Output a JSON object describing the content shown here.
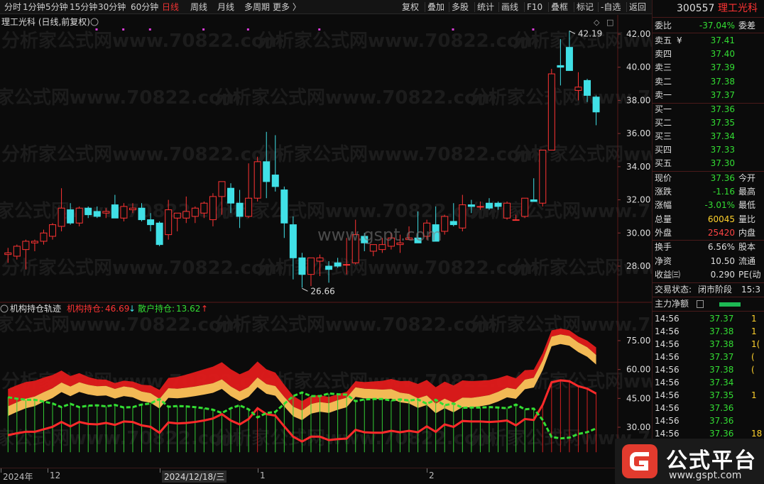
{
  "toolbar": {
    "items": [
      "分时",
      "1分钟",
      "5分钟",
      "15分钟",
      "30分钟",
      "60分钟",
      "日线",
      "周线",
      "月线",
      "多周期",
      "更多 〉"
    ],
    "active": "日线",
    "right": [
      "复权",
      "叠加",
      "多股",
      "统计",
      "画线",
      "F10",
      "叠框",
      "标记",
      "-自选",
      "返回"
    ]
  },
  "chart": {
    "title": "理工光科 (日线,前复权)",
    "price_axis": [
      "42.00",
      "40.00",
      "38.00",
      "36.00",
      "34.00",
      "32.00",
      "30.00",
      "28.00"
    ],
    "max_label": "42.19",
    "min_label": "26.66",
    "watermark_site": "www.gspt.com",
    "watermark_text": "分析家公式网www.70822.com"
  },
  "candles": [
    [
      28.7,
      29.1,
      28.2,
      28.8
    ],
    [
      28.6,
      29.3,
      28.4,
      29.2
    ],
    [
      29.0,
      29.6,
      27.8,
      29.5
    ],
    [
      29.4,
      29.6,
      28.9,
      29.5
    ],
    [
      29.5,
      30.2,
      29.3,
      30.0
    ],
    [
      29.8,
      30.6,
      29.6,
      30.5
    ],
    [
      30.4,
      32.7,
      30.1,
      31.5
    ],
    [
      31.4,
      31.8,
      30.5,
      30.6
    ],
    [
      30.6,
      31.6,
      30.4,
      31.5
    ],
    [
      31.5,
      31.6,
      30.9,
      31.1
    ],
    [
      31.3,
      31.6,
      30.9,
      31.0
    ],
    [
      31.2,
      31.5,
      30.9,
      31.3
    ],
    [
      31.7,
      32.3,
      30.9,
      30.9
    ],
    [
      30.9,
      31.8,
      30.7,
      31.6
    ],
    [
      31.4,
      31.8,
      31.2,
      31.5
    ],
    [
      31.5,
      31.8,
      30.7,
      30.8
    ],
    [
      30.8,
      31.2,
      30.1,
      30.5
    ],
    [
      30.6,
      30.7,
      29.2,
      29.3
    ],
    [
      29.9,
      32.0,
      29.6,
      31.4
    ],
    [
      30.9,
      31.2,
      30.1,
      31.2
    ],
    [
      30.9,
      32.2,
      30.6,
      31.3
    ],
    [
      31.0,
      31.6,
      30.6,
      31.5
    ],
    [
      31.2,
      31.9,
      30.9,
      31.8
    ],
    [
      30.8,
      32.4,
      30.4,
      32.2
    ],
    [
      32.2,
      33.0,
      31.1,
      33.1
    ],
    [
      32.7,
      33.0,
      31.2,
      31.8
    ],
    [
      31.8,
      32.6,
      30.3,
      31.0
    ],
    [
      31.0,
      34.2,
      30.9,
      32.1
    ],
    [
      32.1,
      34.6,
      31.9,
      34.3
    ],
    [
      34.3,
      36.1,
      32.1,
      33.1
    ],
    [
      33.5,
      35.9,
      32.5,
      32.8
    ],
    [
      32.6,
      32.8,
      29.7,
      30.6
    ],
    [
      30.5,
      31.0,
      27.2,
      28.5
    ],
    [
      28.5,
      28.8,
      26.7,
      27.5
    ],
    [
      27.5,
      28.5,
      26.8,
      28.5
    ],
    [
      28.3,
      28.7,
      27.4,
      28.5
    ],
    [
      28.0,
      28.3,
      27.0,
      27.8
    ],
    [
      28.2,
      28.5,
      27.9,
      28.0
    ],
    [
      28.1,
      29.7,
      27.5,
      28.1
    ],
    [
      28.2,
      30.8,
      28.1,
      29.9
    ],
    [
      29.8,
      30.0,
      28.9,
      29.4
    ],
    [
      28.9,
      29.3,
      28.6,
      29.3
    ],
    [
      29.0,
      29.7,
      28.8,
      29.3
    ],
    [
      29.2,
      30.0,
      29.0,
      29.7
    ],
    [
      29.3,
      29.9,
      28.8,
      29.4
    ],
    [
      29.6,
      30.4,
      29.6,
      29.7
    ],
    [
      29.7,
      31.3,
      29.7,
      29.4
    ],
    [
      29.8,
      30.8,
      29.6,
      30.6
    ],
    [
      30.5,
      31.6,
      30.3,
      29.5
    ],
    [
      30.1,
      31.1,
      29.9,
      31.0
    ],
    [
      30.7,
      31.8,
      30.4,
      30.5
    ],
    [
      30.3,
      32.3,
      30.1,
      31.7
    ],
    [
      31.7,
      32.0,
      31.2,
      31.6
    ],
    [
      31.6,
      31.9,
      31.4,
      31.6
    ],
    [
      31.8,
      32.1,
      31.4,
      31.5
    ],
    [
      31.8,
      31.9,
      31.4,
      31.6
    ],
    [
      30.9,
      31.9,
      30.8,
      31.8
    ],
    [
      30.8,
      31.1,
      30.8,
      30.8
    ],
    [
      31.0,
      31.9,
      30.9,
      32.1
    ],
    [
      32.0,
      33.3,
      31.9,
      31.9
    ],
    [
      31.8,
      34.6,
      31.6,
      35.0
    ],
    [
      35.0,
      39.9,
      35.0,
      39.6
    ],
    [
      40.1,
      41.7,
      38.9,
      40.0
    ],
    [
      41.2,
      42.19,
      39.9,
      39.8
    ],
    [
      38.6,
      39.7,
      38.0,
      38.8
    ],
    [
      39.2,
      39.3,
      37.9,
      38.3
    ],
    [
      38.2,
      38.3,
      36.5,
      37.3
    ]
  ],
  "indicator": {
    "title": "机构持仓轨迹",
    "jg_label": "机构持仓:",
    "jg_value": "46.69",
    "jg_arrow": "↓",
    "sh_label": "散户持仓:",
    "sh_value": "13.62",
    "sh_arrow": "↑",
    "axis": [
      "75.00",
      "60.00",
      "45.00",
      "30.00"
    ]
  },
  "time_axis": [
    {
      "label": "2024年",
      "box": false
    },
    {
      "label": "12",
      "box": false
    },
    {
      "label": "2024/12/18/三",
      "box": true
    },
    {
      "label": "1",
      "box": false
    },
    {
      "label": "2",
      "box": false
    }
  ],
  "stock": {
    "code": "300557",
    "name": "理工光科"
  },
  "ratio": {
    "label": "委比",
    "value": "-37.04%",
    "right": "委差"
  },
  "asks": [
    {
      "label": "卖五",
      "value": "37.41",
      "mark": "¥"
    },
    {
      "label": "卖四",
      "value": "37.40"
    },
    {
      "label": "卖三",
      "value": "37.39"
    },
    {
      "label": "卖二",
      "value": "37.38"
    },
    {
      "label": "卖一",
      "value": "37.37"
    }
  ],
  "bids": [
    {
      "label": "买一",
      "value": "37.36"
    },
    {
      "label": "买二",
      "value": "37.35"
    },
    {
      "label": "买三",
      "value": "37.34"
    },
    {
      "label": "买四",
      "value": "37.33"
    },
    {
      "label": "买五",
      "value": "37.30"
    }
  ],
  "quote": [
    {
      "label": "现价",
      "value": "37.36",
      "right": "今开",
      "color": "green"
    },
    {
      "label": "涨跌",
      "value": "-1.16",
      "right": "最高",
      "color": "green"
    },
    {
      "label": "涨幅",
      "value": "-3.01%",
      "right": "最低",
      "color": "green"
    },
    {
      "label": "总量",
      "value": "60045",
      "right": "量比",
      "color": "yellow"
    },
    {
      "label": "外盘",
      "value": "25420",
      "right": "内盘",
      "color": "red"
    }
  ],
  "stats": [
    {
      "label": "换手",
      "value": "6.56%",
      "right": "股本"
    },
    {
      "label": "净资",
      "value": "10.50",
      "right": "流通"
    },
    {
      "label": "收益㈢",
      "value": "0.290",
      "right": "PE(动"
    }
  ],
  "trade_state": {
    "label": "交易状态:",
    "value": "闭市阶段",
    "time": "15:3"
  },
  "main_net": {
    "label": "主力净额"
  },
  "ticks": [
    {
      "time": "14:56",
      "price": "37.37",
      "vol": "1"
    },
    {
      "time": "14:56",
      "price": "37.38",
      "vol": "1"
    },
    {
      "time": "14:56",
      "price": "37.38",
      "vol": "1("
    },
    {
      "time": "14:56",
      "price": "37.37",
      "vol": "("
    },
    {
      "time": "14:56",
      "price": "37.38",
      "vol": "("
    },
    {
      "time": "14:56",
      "price": "37.34",
      "vol": ""
    },
    {
      "time": "14:56",
      "price": "37.35",
      "vol": "1"
    },
    {
      "time": "14:56",
      "price": "37.36",
      "vol": ""
    },
    {
      "time": "14:56",
      "price": "37.36",
      "vol": ""
    },
    {
      "time": "14:56",
      "price": "37.36",
      "vol": "18"
    }
  ],
  "logo": {
    "title": "公式平台",
    "url": "www.gspt.com"
  }
}
